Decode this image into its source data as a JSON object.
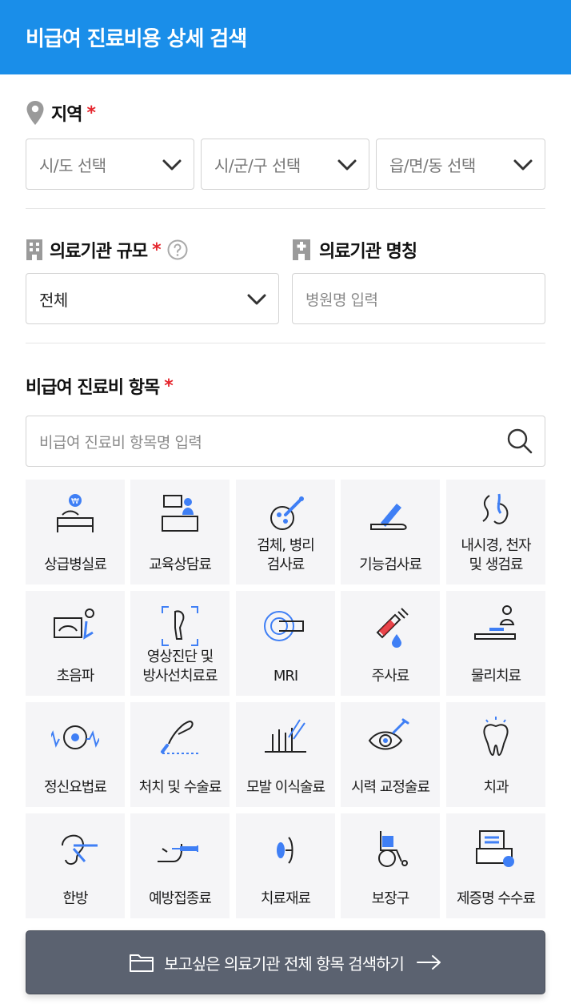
{
  "header": {
    "title": "비급여 진료비용 상세 검색"
  },
  "region": {
    "label": "지역",
    "required_mark": "*",
    "selects": [
      "시/도 선택",
      "시/군/구 선택",
      "읍/면/동 선택"
    ]
  },
  "hospital": {
    "scale_label": "의료기관 규모",
    "scale_required_mark": "*",
    "scale_value": "전체",
    "name_label": "의료기관 명칭",
    "name_placeholder": "병원명 입력"
  },
  "items": {
    "label": "비급여 진료비 항목",
    "required_mark": "*",
    "search_placeholder": "비급여 진료비 항목명 입력",
    "tiles": [
      {
        "label": "상급병실료",
        "icon": "hospital-bed-icon"
      },
      {
        "label": "교육상담료",
        "icon": "consultation-desk-icon"
      },
      {
        "label": "검체, 병리\n검사료",
        "icon": "specimen-test-icon"
      },
      {
        "label": "기능검사료",
        "icon": "function-test-icon"
      },
      {
        "label": "내시경, 천자\n및 생검료",
        "icon": "endoscope-icon"
      },
      {
        "label": "초음파",
        "icon": "ultrasound-icon"
      },
      {
        "label": "영상진단 및\n방사선치료료",
        "icon": "xray-icon"
      },
      {
        "label": "MRI",
        "icon": "mri-icon"
      },
      {
        "label": "주사료",
        "icon": "syringe-icon"
      },
      {
        "label": "물리치료",
        "icon": "physical-therapy-icon"
      },
      {
        "label": "정신요법료",
        "icon": "brain-wave-icon"
      },
      {
        "label": "처치 및 수술료",
        "icon": "scalpel-hand-icon"
      },
      {
        "label": "모발 이식술료",
        "icon": "hair-transplant-icon"
      },
      {
        "label": "시력 교정술료",
        "icon": "eye-surgery-icon"
      },
      {
        "label": "치과",
        "icon": "tooth-icon"
      },
      {
        "label": "한방",
        "icon": "acupuncture-ear-icon"
      },
      {
        "label": "예방접종료",
        "icon": "vaccination-icon"
      },
      {
        "label": "치료재료",
        "icon": "treatment-material-icon"
      },
      {
        "label": "보장구",
        "icon": "wheelchair-icon"
      },
      {
        "label": "제증명 수수료",
        "icon": "certificate-icon"
      }
    ]
  },
  "cta": {
    "label": "보고싶은 의료기관 전체 항목 검색하기"
  },
  "colors": {
    "header_bg": "#1a8ee9",
    "required": "#e5262d",
    "accent_icon": "#3f7ff5",
    "cta_bg": "#5b6270"
  }
}
